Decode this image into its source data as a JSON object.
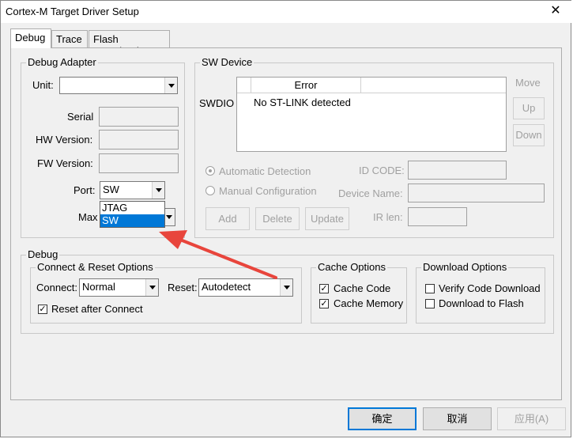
{
  "window": {
    "title": "Cortex-M Target Driver Setup",
    "close_glyph": "✕"
  },
  "tabs": [
    {
      "label": "Debug"
    },
    {
      "label": "Trace"
    },
    {
      "label": "Flash Download"
    }
  ],
  "debug_adapter": {
    "title": "Debug Adapter",
    "unit_label": "Unit:",
    "unit_value": "",
    "serial_label": "Serial",
    "serial_value": "",
    "hw_label": "HW Version:",
    "hw_value": "",
    "fw_label": "FW Version:",
    "fw_value": "",
    "port_label": "Port:",
    "port_value": "SW",
    "port_options": [
      "JTAG",
      "SW"
    ],
    "max_label": "Max"
  },
  "sw_device": {
    "title": "SW Device",
    "swdio_label": "SWDIO",
    "col_error": "Error",
    "row_text": "No ST-LINK detected",
    "move_label": "Move",
    "up_label": "Up",
    "down_label": "Down",
    "auto_detect": "Automatic Detection",
    "manual_config": "Manual Configuration",
    "id_code_label": "ID CODE:",
    "device_name_label": "Device Name:",
    "ir_len_label": "IR len:",
    "add_label": "Add",
    "delete_label": "Delete",
    "update_label": "Update"
  },
  "debug_section": {
    "title": "Debug",
    "connect_reset": {
      "title": "Connect & Reset Options",
      "connect_label": "Connect:",
      "connect_value": "Normal",
      "reset_label": "Reset:",
      "reset_value": "Autodetect",
      "reset_after_connect": "Reset after Connect"
    },
    "cache": {
      "title": "Cache Options",
      "cache_code": "Cache Code",
      "cache_memory": "Cache Memory"
    },
    "download": {
      "title": "Download Options",
      "verify": "Verify Code Download",
      "download_flash": "Download to Flash"
    }
  },
  "footer": {
    "ok": "确定",
    "cancel": "取消",
    "apply": "应用(A)"
  },
  "colors": {
    "accent": "#0078d7",
    "arrow": "#e8453c"
  },
  "icons": {
    "check": "✓"
  }
}
